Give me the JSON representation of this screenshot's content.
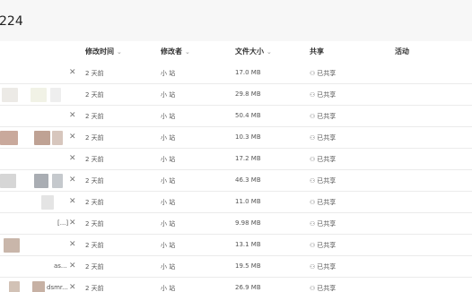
{
  "title": "224",
  "columns": {
    "modified_time": "修改时间",
    "modifier": "修改者",
    "file_size": "文件大小",
    "share": "共享",
    "activity": "活动"
  },
  "sort_chevron": "⌄",
  "rows": [
    {
      "time": "2 天前",
      "modifier": "小 站",
      "size": "17.0 MB",
      "share": "已共享",
      "caption": ""
    },
    {
      "time": "2 天前",
      "modifier": "小 站",
      "size": "29.8 MB",
      "share": "已共享",
      "caption": ""
    },
    {
      "time": "2 天前",
      "modifier": "小 站",
      "size": "50.4 MB",
      "share": "已共享",
      "caption": ""
    },
    {
      "time": "2 天前",
      "modifier": "小 站",
      "size": "10.3 MB",
      "share": "已共享",
      "caption": ""
    },
    {
      "time": "2 天前",
      "modifier": "小 站",
      "size": "17.2 MB",
      "share": "已共享",
      "caption": ""
    },
    {
      "time": "2 天前",
      "modifier": "小 站",
      "size": "46.3 MB",
      "share": "已共享",
      "caption": ""
    },
    {
      "time": "2 天前",
      "modifier": "小 站",
      "size": "11.0 MB",
      "share": "已共享",
      "caption": ""
    },
    {
      "time": "2 天前",
      "modifier": "小 站",
      "size": "9.98 MB",
      "share": "已共享",
      "caption": "[...]"
    },
    {
      "time": "2 天前",
      "modifier": "小 站",
      "size": "13.1 MB",
      "share": "已共享",
      "caption": ""
    },
    {
      "time": "2 天前",
      "modifier": "小 站",
      "size": "19.5 MB",
      "share": "已共享",
      "caption": "as..."
    },
    {
      "time": "2 天前",
      "modifier": "小 站",
      "size": "26.9 MB",
      "share": "已共享",
      "caption": "dsmr..."
    }
  ],
  "colors": {
    "title_bar_bg": "#f7f7f7",
    "row_border": "#ebebeb",
    "text": "#555555"
  },
  "icons": {
    "row_action": "pin-off-icon",
    "share": "people-icon",
    "sort": "chevron-down-icon"
  }
}
